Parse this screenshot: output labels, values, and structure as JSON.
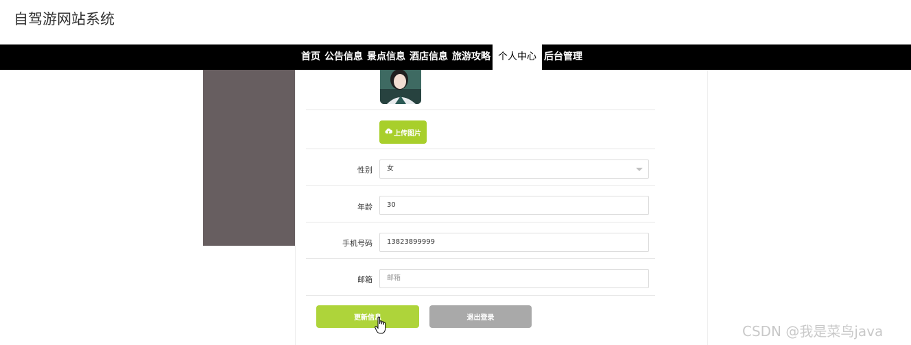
{
  "site": {
    "title": "自驾游网站系统"
  },
  "nav": {
    "items": [
      {
        "label": "首页",
        "active": false
      },
      {
        "label": "公告信息",
        "active": false
      },
      {
        "label": "景点信息",
        "active": false
      },
      {
        "label": "酒店信息",
        "active": false
      },
      {
        "label": "旅游攻略",
        "active": false
      },
      {
        "label": "个人中心",
        "active": true
      },
      {
        "label": "后台管理",
        "active": false
      }
    ]
  },
  "profile": {
    "upload_label": "上传图片",
    "fields": {
      "gender": {
        "label": "性别",
        "value": "女"
      },
      "age": {
        "label": "年龄",
        "value": "30"
      },
      "phone": {
        "label": "手机号码",
        "value": "13823899999"
      },
      "email": {
        "label": "邮箱",
        "value": "",
        "placeholder": "邮箱"
      }
    },
    "update_label": "更新信息",
    "logout_label": "退出登录"
  },
  "watermark": "CSDN @我是菜鸟java",
  "colors": {
    "navbar": "#000000",
    "accent_green": "#a8cf2b",
    "logout_gray": "#a9a9a9",
    "side_panel": "#675e60"
  },
  "icons": [
    "cloud-upload-icon",
    "hand-pointer-icon",
    "chevron-down-icon"
  ]
}
